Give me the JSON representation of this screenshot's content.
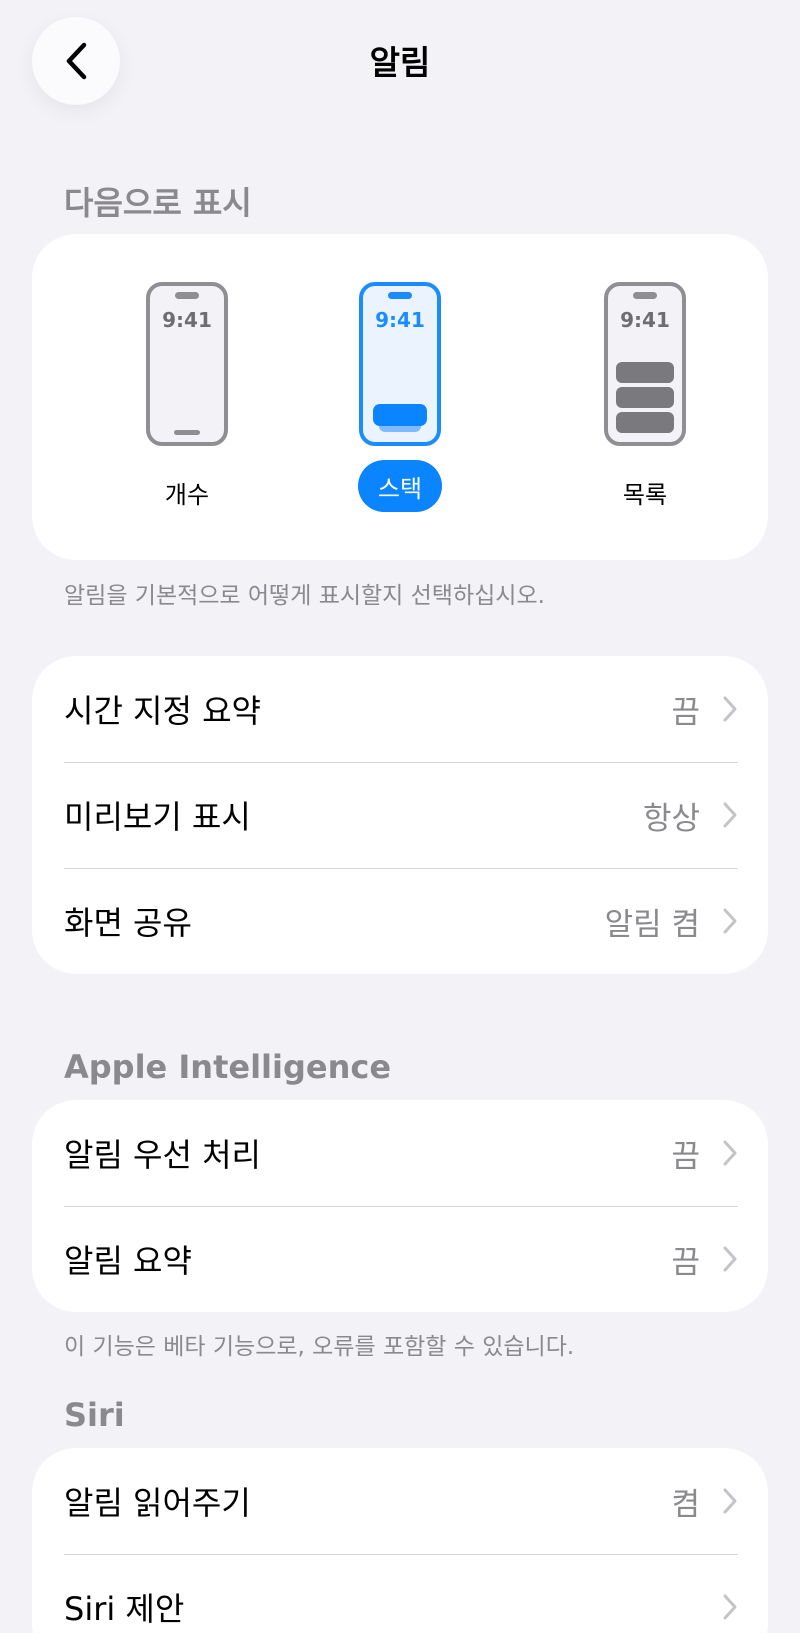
{
  "nav": {
    "title": "알림",
    "back_icon": "chevron-left-icon"
  },
  "display_as": {
    "header": "다음으로 표시",
    "footnote": "알림을 기본적으로 어떻게 표시할지 선택하십시오.",
    "phone_time": "9:41",
    "options": [
      {
        "label": "개수",
        "selected": false
      },
      {
        "label": "스택",
        "selected": true
      },
      {
        "label": "목록",
        "selected": false
      }
    ],
    "accent_color": "#0a84ff"
  },
  "general_settings": {
    "rows": [
      {
        "label": "시간 지정 요약",
        "value": "끔"
      },
      {
        "label": "미리보기 표시",
        "value": "항상"
      },
      {
        "label": "화면 공유",
        "value": "알림 켬"
      }
    ]
  },
  "apple_intelligence": {
    "header": "Apple Intelligence",
    "rows": [
      {
        "label": "알림 우선 처리",
        "value": "끔"
      },
      {
        "label": "알림 요약",
        "value": "끔"
      }
    ],
    "footnote": "이 기능은 베타 기능으로, 오류를 포함할 수 있습니다."
  },
  "siri": {
    "header": "Siri",
    "rows": [
      {
        "label": "알림 읽어주기",
        "value": "켬"
      },
      {
        "label": "Siri 제안",
        "value": ""
      }
    ]
  }
}
